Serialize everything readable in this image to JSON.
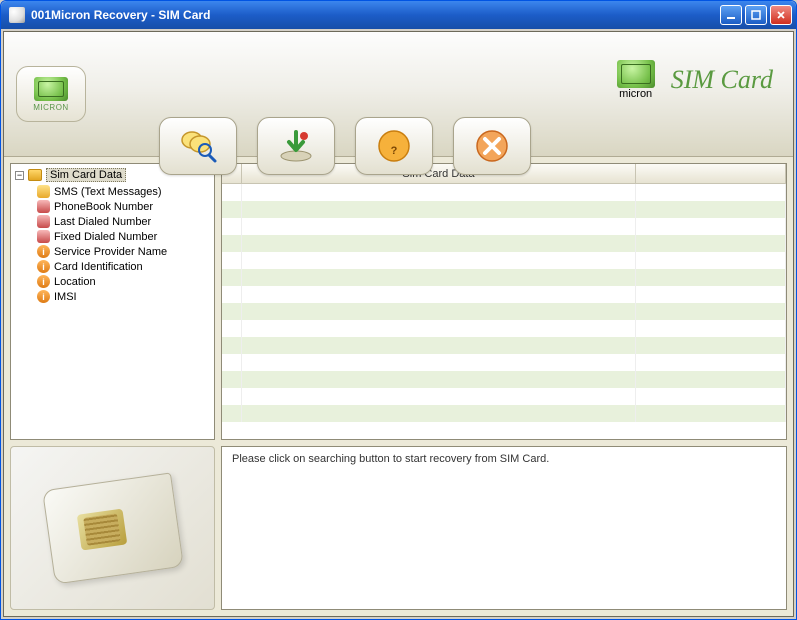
{
  "window": {
    "title": "001Micron Recovery - SIM Card"
  },
  "logo": {
    "text": "MICRON"
  },
  "branding": {
    "brand": "micron",
    "product": "SIM Card"
  },
  "toolbar": {
    "search": "Search",
    "save": "Save",
    "help": "Help",
    "stop": "Stop"
  },
  "tree": {
    "root": "Sim Card Data",
    "items": [
      {
        "label": "SMS (Text Messages)",
        "icon": "msg"
      },
      {
        "label": "PhoneBook Number",
        "icon": "phone"
      },
      {
        "label": "Last Dialed Number",
        "icon": "phone"
      },
      {
        "label": "Fixed Dialed Number",
        "icon": "phone"
      },
      {
        "label": "Service Provider Name",
        "icon": "info"
      },
      {
        "label": "Card Identification",
        "icon": "info"
      },
      {
        "label": "Location",
        "icon": "info"
      },
      {
        "label": "IMSI",
        "icon": "info"
      }
    ]
  },
  "grid": {
    "header": "Sim Card Data",
    "blank_rows": 14
  },
  "status": {
    "message": "Please click on searching button to start recovery from SIM Card."
  }
}
